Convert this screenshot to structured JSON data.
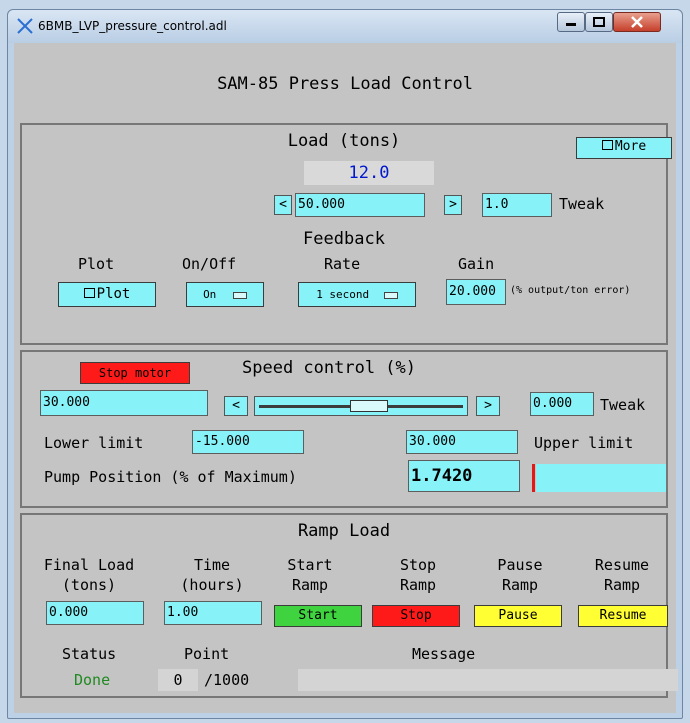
{
  "window": {
    "title": "6BMB_LVP_pressure_control.adl"
  },
  "main_title": "SAM-85 Press Load Control",
  "load": {
    "heading": "Load (tons)",
    "value": "12.0",
    "more_label": "More",
    "setpoint": "50.000",
    "tweak_value": "1.0",
    "tweak_label": "Tweak",
    "dec": "<",
    "inc": ">"
  },
  "feedback": {
    "heading": "Feedback",
    "plot_label": "Plot",
    "onoff_label": "On/Off",
    "rate_label": "Rate",
    "gain_label": "Gain",
    "plot_button": "Plot",
    "onoff_value": "On",
    "rate_value": "1 second",
    "gain_value": "20.000",
    "gain_units": "(% output/ton error)"
  },
  "speed": {
    "stop_motor": "Stop motor",
    "heading": "Speed control (%)",
    "value": "30.000",
    "dec": "<",
    "inc": ">",
    "slider_level": 0.55,
    "tweak_value": "0.000",
    "tweak_label": "Tweak",
    "lower_label": "Lower limit",
    "lower_value": "-15.000",
    "upper_value": "30.000",
    "upper_label": "Upper limit",
    "pump_label": "Pump Position (% of Maximum)",
    "pump_value": "1.7420"
  },
  "ramp": {
    "heading": "Ramp Load",
    "final_label_1": "Final Load",
    "final_label_2": "(tons)",
    "time_label_1": "Time",
    "time_label_2": "(hours)",
    "start_label_1": "Start",
    "start_label_2": "Ramp",
    "stop_label_1": "Stop",
    "stop_label_2": "Ramp",
    "pause_label_1": "Pause",
    "pause_label_2": "Ramp",
    "resume_label_1": "Resume",
    "resume_label_2": "Ramp",
    "final_value": "0.000",
    "time_value": "1.00",
    "start_button": "Start",
    "stop_button": "Stop",
    "pause_button": "Pause",
    "resume_button": "Resume",
    "status_label": "Status",
    "point_label": "Point",
    "message_label": "Message",
    "status_value": "Done",
    "point_value": "0",
    "point_total": "/1000"
  },
  "colors": {
    "field": "#87f2f7",
    "stop_red": "#ff1a1a",
    "start_green": "#3fd43f",
    "pause_yellow": "#ffff33",
    "value_blue": "#0019cf",
    "status_green": "#1f8a1f"
  }
}
